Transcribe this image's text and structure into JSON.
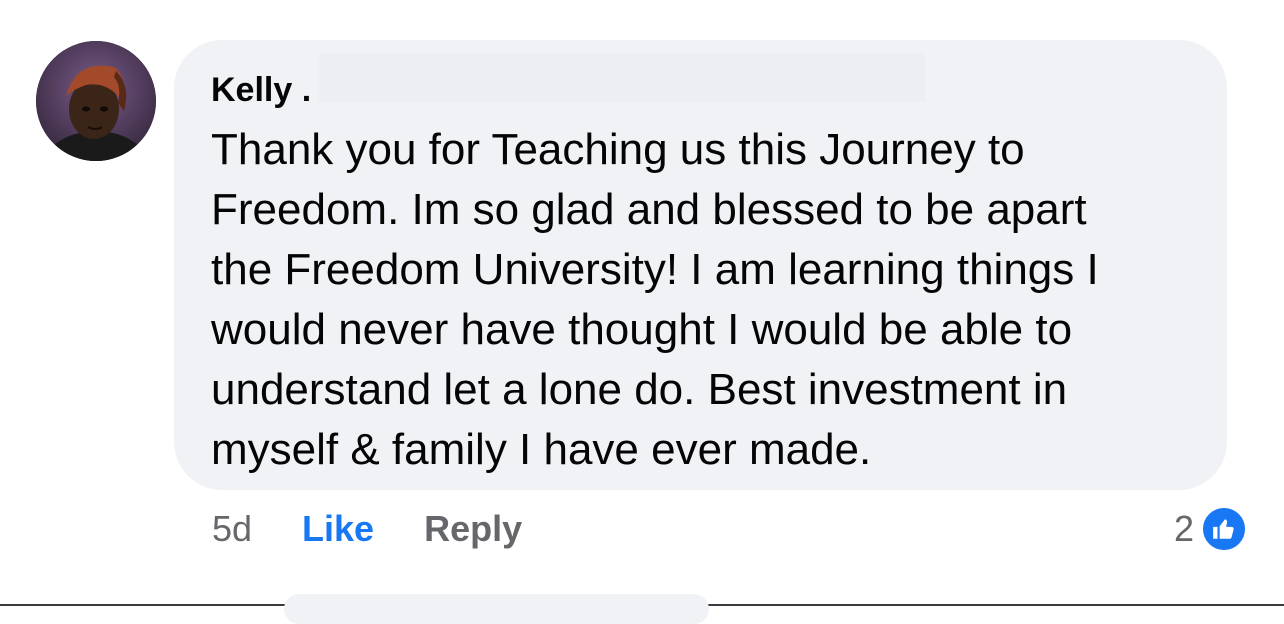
{
  "comment": {
    "author": "Kelly .",
    "text": "Thank you for Teaching us this Journey to\nFreedom. Im so glad and blessed to be apart\nthe Freedom University! I am learning things I\nwould never have thought I would be able to\nunderstand let a lone do. Best investment in\nmyself & family I have ever made.",
    "time": "5d",
    "like_label": "Like",
    "reply_label": "Reply",
    "reaction_count": "2",
    "reaction_icon": "thumbs-up-icon"
  },
  "colors": {
    "bubble": "#f0f2f5",
    "link_blue": "#1877f2",
    "secondary_text": "#65676b",
    "primary_text": "#050505"
  }
}
